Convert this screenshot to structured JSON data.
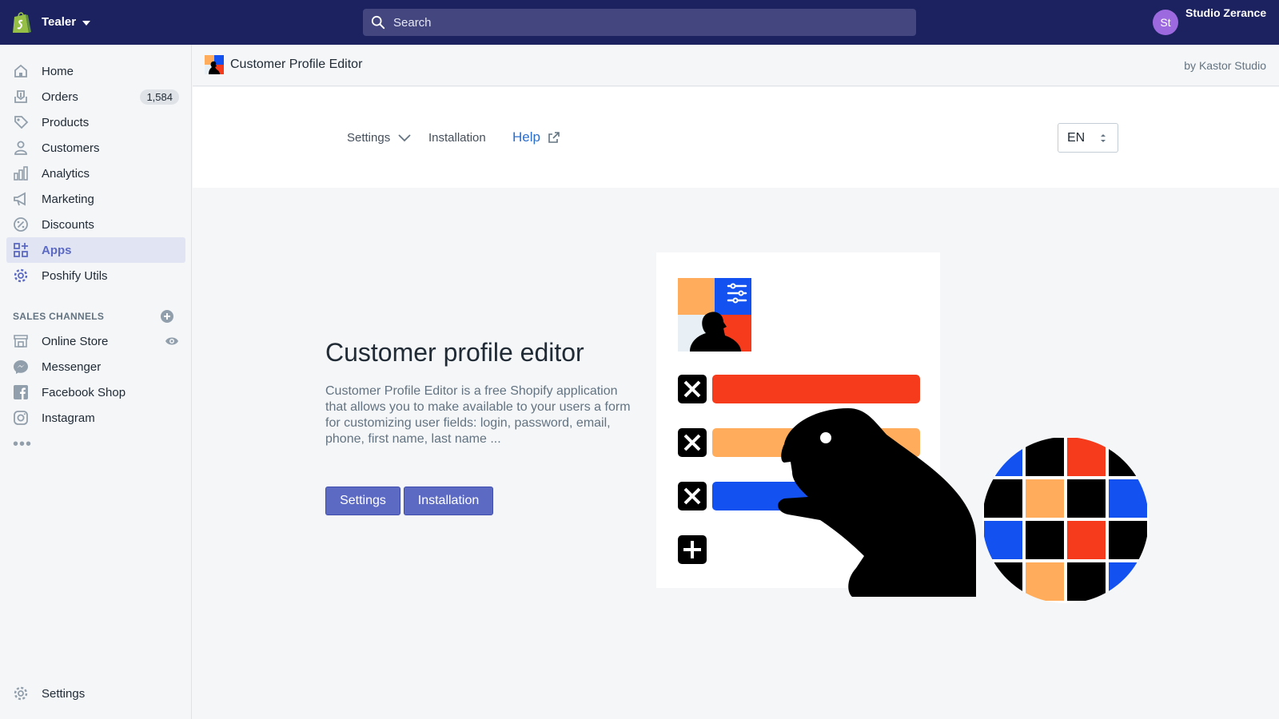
{
  "topbar": {
    "store_name": "Tealer",
    "search_placeholder": "Search",
    "avatar_initials": "St",
    "user_name": "Studio Zerance",
    "bg_color": "#1c2260"
  },
  "sidebar": {
    "items": [
      {
        "label": "Home",
        "icon": "home-icon"
      },
      {
        "label": "Orders",
        "icon": "orders-icon",
        "badge": "1,584"
      },
      {
        "label": "Products",
        "icon": "tag-icon"
      },
      {
        "label": "Customers",
        "icon": "person-icon"
      },
      {
        "label": "Analytics",
        "icon": "bar-chart-icon"
      },
      {
        "label": "Marketing",
        "icon": "megaphone-icon"
      },
      {
        "label": "Discounts",
        "icon": "discount-icon"
      },
      {
        "label": "Apps",
        "icon": "apps-icon",
        "active": true
      },
      {
        "label": "Poshify Utils",
        "icon": "gear-icon"
      }
    ],
    "sales_channels_title": "SALES CHANNELS",
    "channels": [
      {
        "label": "Online Store",
        "icon": "store-icon"
      },
      {
        "label": "Messenger",
        "icon": "messenger-icon"
      },
      {
        "label": "Facebook Shop",
        "icon": "facebook-icon"
      },
      {
        "label": "Instagram",
        "icon": "instagram-icon"
      }
    ],
    "more_label": "•••",
    "settings_label": "Settings",
    "active_color": "#5c6ac4"
  },
  "app_header": {
    "title": "Customer Profile Editor",
    "by": "by Kastor Studio"
  },
  "tabs": {
    "settings": "Settings",
    "installation": "Installation",
    "help": "Help",
    "language": "EN"
  },
  "hero": {
    "title": "Customer profile editor",
    "description": "Customer Profile Editor is a free Shopify application that allows you to make available to your users a form for customizing user fields: login, password, email, phone, first name, last name ...",
    "settings_button": "Settings",
    "installation_button": "Installation"
  },
  "colors": {
    "primary": "#5c6ac4",
    "link": "#2c6ecb",
    "illus_red": "#f53b1b",
    "illus_orange": "#ffad5c",
    "illus_blue": "#1352f0"
  }
}
